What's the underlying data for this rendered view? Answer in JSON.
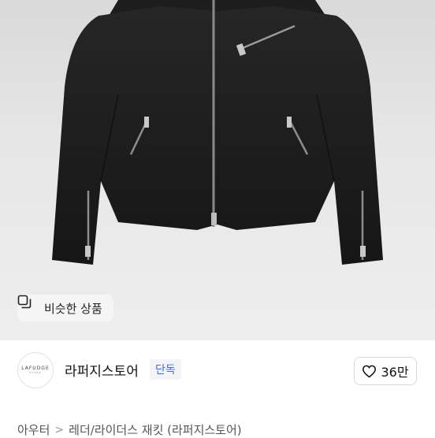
{
  "product_image": {
    "alt": "black suede rider jacket"
  },
  "similar_chip": {
    "label": "비슷한 상품",
    "icon": "similar-items-icon"
  },
  "store": {
    "logo_text": "LAFUDGE",
    "logo_sub": "STORE",
    "name": "라퍼지스토어",
    "badge": "단독"
  },
  "like": {
    "count": "36만",
    "icon": "heart-outline-icon"
  },
  "breadcrumb": {
    "first": "아우터",
    "separator": ">",
    "second": "레더/라이더스 재킷 (라퍼지스토어)"
  }
}
